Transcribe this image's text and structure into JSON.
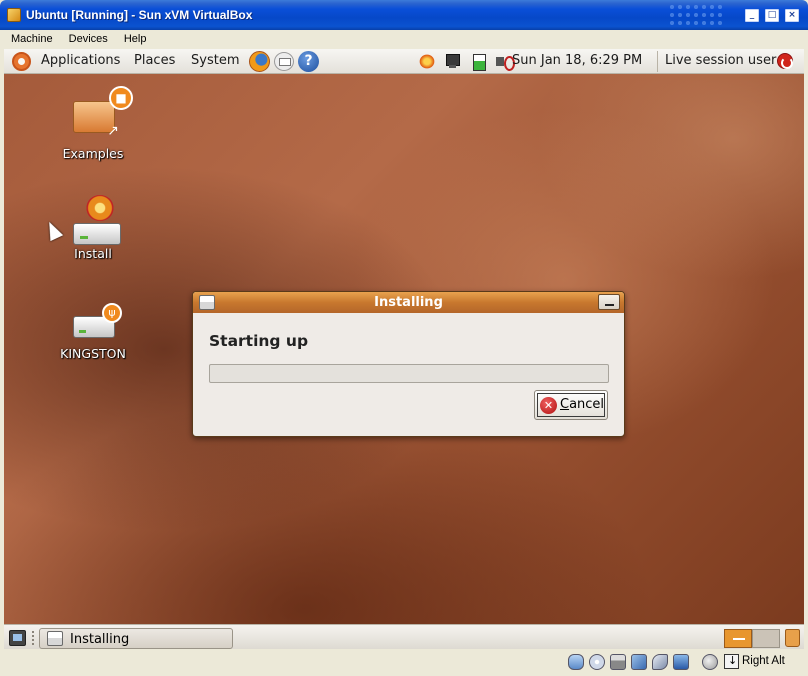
{
  "host_window": {
    "title": "Ubuntu [Running] - Sun xVM VirtualBox",
    "menu": [
      "Machine",
      "Devices",
      "Help"
    ],
    "host_key_label": "Right Alt"
  },
  "top_panel": {
    "menus": [
      "Applications",
      "Places",
      "System"
    ],
    "clock": "Sun Jan 18,  6:29 PM",
    "session_label": "Live session user"
  },
  "desktop_icons": [
    {
      "label": "Examples"
    },
    {
      "label": "Install"
    },
    {
      "label": "KINGSTON"
    }
  ],
  "dialog": {
    "title": "Installing",
    "heading": "Starting up",
    "progress": 0,
    "cancel": {
      "mnemonic": "C",
      "rest": "ancel"
    }
  },
  "bottom_panel": {
    "task_label": "Installing"
  },
  "icons": {
    "panel": [
      "ubuntu-logo",
      "firefox-icon",
      "mail-icon",
      "help-icon",
      "update-notifier-icon",
      "network-icon",
      "battery-icon",
      "volume-icon",
      "power-icon"
    ],
    "statusbar": [
      "hard-disk-icon",
      "cd-dvd-icon",
      "floppy-icon",
      "network-icon",
      "usb-icon",
      "shared-folders-icon",
      "mouse-integration-icon"
    ]
  },
  "colors": {
    "host_titlebar": "#0648c8",
    "dialog_titlebar": "#c8782e",
    "workspace_active": "#e8962e",
    "desktop_background": "#a45a3a"
  }
}
